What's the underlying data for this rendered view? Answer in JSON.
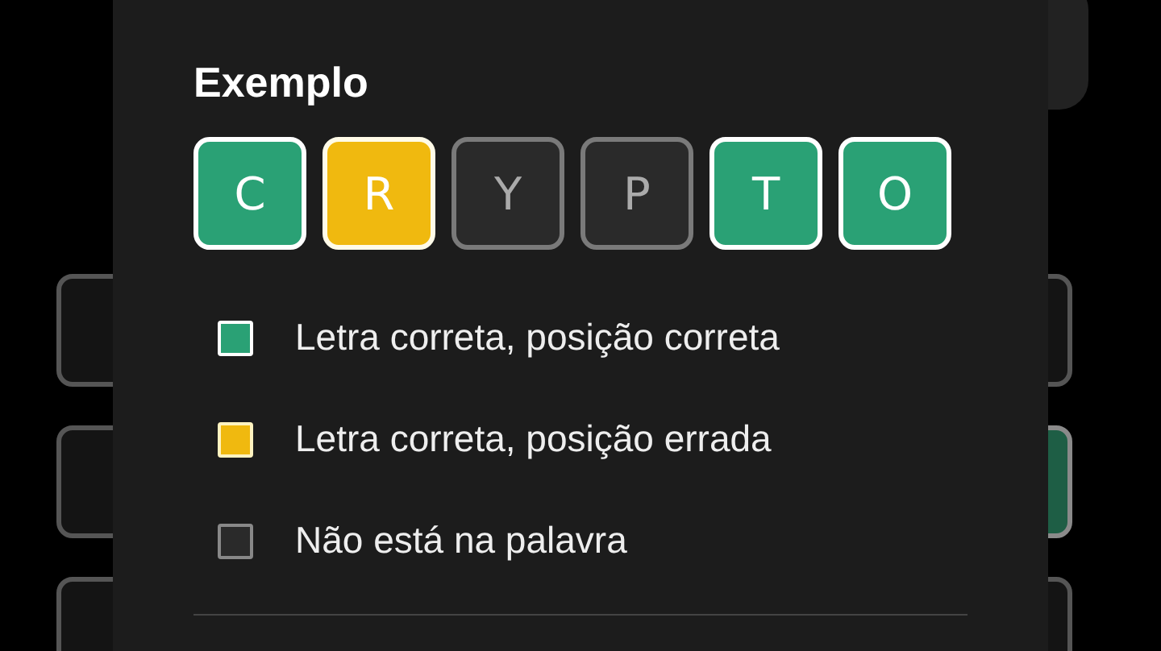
{
  "board": {
    "rows": [
      {
        "tiles": [
          {
            "kind": "empty"
          },
          {
            "kind": "empty"
          }
        ]
      },
      {
        "tiles": [
          {
            "kind": "empty"
          },
          {
            "kind": "correct"
          }
        ]
      },
      {
        "tiles": [
          {
            "kind": "empty"
          },
          {
            "kind": "empty"
          }
        ]
      }
    ]
  },
  "dialog": {
    "title": "Exemplo",
    "example_tiles": [
      {
        "letter": "C",
        "kind": "correct"
      },
      {
        "letter": "R",
        "kind": "present"
      },
      {
        "letter": "Y",
        "kind": "absent"
      },
      {
        "letter": "P",
        "kind": "absent"
      },
      {
        "letter": "T",
        "kind": "correct"
      },
      {
        "letter": "O",
        "kind": "correct"
      }
    ],
    "legend": [
      {
        "kind": "correct",
        "label": "Letra correta, posição correta"
      },
      {
        "kind": "present",
        "label": "Letra correta, posição errada"
      },
      {
        "kind": "absent",
        "label": "Não está na palavra"
      }
    ]
  }
}
